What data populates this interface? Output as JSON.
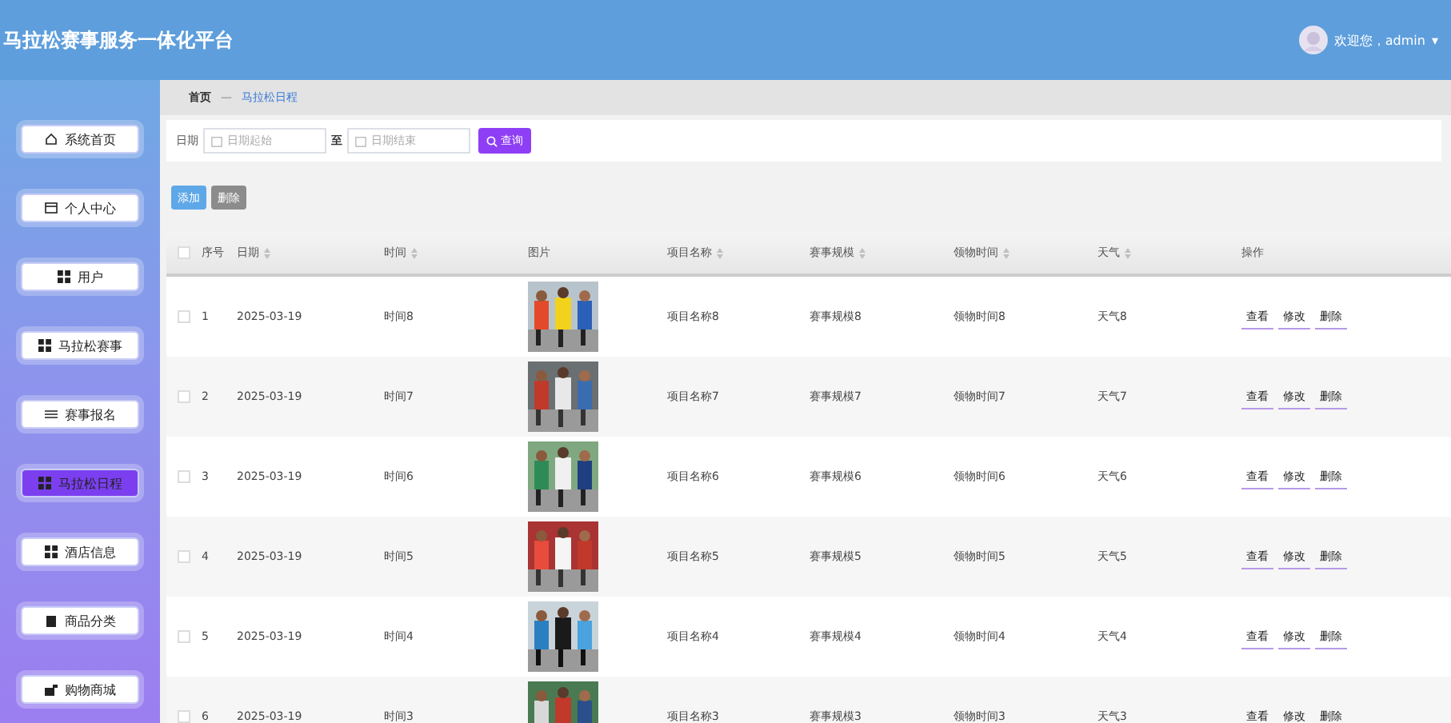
{
  "header": {
    "title": "马拉松赛事服务一体化平台",
    "greeting": "欢迎您，admin",
    "caret": "▾"
  },
  "sidebar": {
    "items": [
      {
        "label": "系统首页",
        "selected": false
      },
      {
        "label": "个人中心",
        "selected": false
      },
      {
        "label": "用户",
        "selected": false
      },
      {
        "label": "马拉松赛事",
        "selected": false
      },
      {
        "label": "赛事报名",
        "selected": false
      },
      {
        "label": "马拉松日程",
        "selected": true
      },
      {
        "label": "酒店信息",
        "selected": false
      },
      {
        "label": "商品分类",
        "selected": false
      },
      {
        "label": "购物商城",
        "selected": false
      }
    ]
  },
  "breadcrumb": {
    "home": "首页",
    "separator": "—",
    "current": "马拉松日程"
  },
  "search": {
    "label": "日期",
    "start_placeholder": "日期起始",
    "to": "至",
    "end_placeholder": "日期结束",
    "button": "查询"
  },
  "actions": {
    "add": "添加",
    "delete": "删除"
  },
  "table": {
    "all_checked": false,
    "columns": [
      {
        "label": "序号",
        "kind": "plain"
      },
      {
        "label": "日期",
        "kind": "sortable"
      },
      {
        "label": "时间",
        "kind": "sortable"
      },
      {
        "label": "图片",
        "kind": "plain"
      },
      {
        "label": "项目名称",
        "kind": "sortable"
      },
      {
        "label": "赛事规模",
        "kind": "sortable"
      },
      {
        "label": "领物时间",
        "kind": "sortable"
      },
      {
        "label": "天气",
        "kind": "sortable"
      },
      {
        "label": "操作",
        "kind": "plain"
      }
    ],
    "rows": [
      {
        "checked": false,
        "index": "1",
        "date": "2025-03-19",
        "time": "时间8",
        "project": "项目名称8",
        "scale": "赛事规模8",
        "pickup": "领物时间8",
        "weather": "天气8",
        "actions": [
          "查看",
          "修改",
          "删除"
        ]
      },
      {
        "checked": false,
        "index": "2",
        "date": "2025-03-19",
        "time": "时间7",
        "project": "项目名称7",
        "scale": "赛事规模7",
        "pickup": "领物时间7",
        "weather": "天气7",
        "actions": [
          "查看",
          "修改",
          "删除"
        ]
      },
      {
        "checked": false,
        "index": "3",
        "date": "2025-03-19",
        "time": "时间6",
        "project": "项目名称6",
        "scale": "赛事规模6",
        "pickup": "领物时间6",
        "weather": "天气6",
        "actions": [
          "查看",
          "修改",
          "删除"
        ]
      },
      {
        "checked": false,
        "index": "4",
        "date": "2025-03-19",
        "time": "时间5",
        "project": "项目名称5",
        "scale": "赛事规模5",
        "pickup": "领物时间5",
        "weather": "天气5",
        "actions": [
          "查看",
          "修改",
          "删除"
        ]
      },
      {
        "checked": false,
        "index": "5",
        "date": "2025-03-19",
        "time": "时间4",
        "project": "项目名称4",
        "scale": "赛事规模4",
        "pickup": "领物时间4",
        "weather": "天气4",
        "actions": [
          "查看",
          "修改",
          "删除"
        ]
      },
      {
        "checked": false,
        "index": "6",
        "date": "2025-03-19",
        "time": "时间3",
        "project": "项目名称3",
        "scale": "赛事规模3",
        "pickup": "领物时间3",
        "weather": "天气3",
        "actions": [
          "查看",
          "修改",
          "删除"
        ]
      }
    ]
  }
}
